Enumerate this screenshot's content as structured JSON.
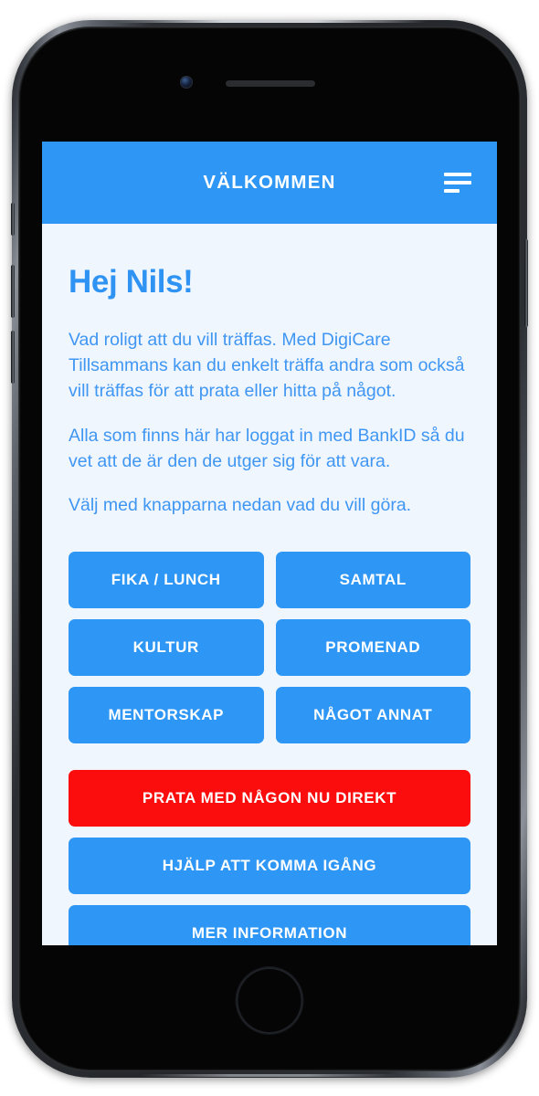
{
  "device": {
    "type": "smartphone-mockup",
    "hardware": {
      "front_camera": "front-camera",
      "earpiece": "earpiece-speaker",
      "home_button": "home-button",
      "silent_switch": "silent-switch",
      "volume_up": "volume-up",
      "volume_down": "volume-down",
      "power_button": "power-button"
    }
  },
  "colors": {
    "brand_blue": "#2E96F5",
    "text_blue": "#3F96F3",
    "heading_blue": "#2F93F4",
    "danger_red": "#FB0D0D",
    "screen_background": "#F0F6FD",
    "button_text": "#FFFFFF"
  },
  "header": {
    "title": "VÄLKOMMEN",
    "menu_icon": "menu-icon"
  },
  "main": {
    "heading": "Hej Nils!",
    "paragraphs": [
      "Vad roligt att du vill träffas. Med DigiCare Tillsammans kan du enkelt träffa andra som också vill träffas för att prata eller hitta på något.",
      "Alla som finns här har loggat in med BankID så du vet att de är den de utger sig för att vara.",
      "Välj med knapparna nedan vad du vill göra."
    ],
    "category_buttons": [
      {
        "label": "FIKA / LUNCH",
        "style": "primary"
      },
      {
        "label": "SAMTAL",
        "style": "primary"
      },
      {
        "label": "KULTUR",
        "style": "primary"
      },
      {
        "label": "PROMENAD",
        "style": "primary"
      },
      {
        "label": "MENTORSKAP",
        "style": "primary"
      },
      {
        "label": "NÅGOT ANNAT",
        "style": "primary"
      }
    ],
    "action_buttons": [
      {
        "label": "PRATA MED NÅGON NU DIREKT",
        "style": "danger"
      },
      {
        "label": "HJÄLP ATT KOMMA IGÅNG",
        "style": "primary"
      },
      {
        "label": "MER INFORMATION",
        "style": "primary"
      }
    ]
  }
}
